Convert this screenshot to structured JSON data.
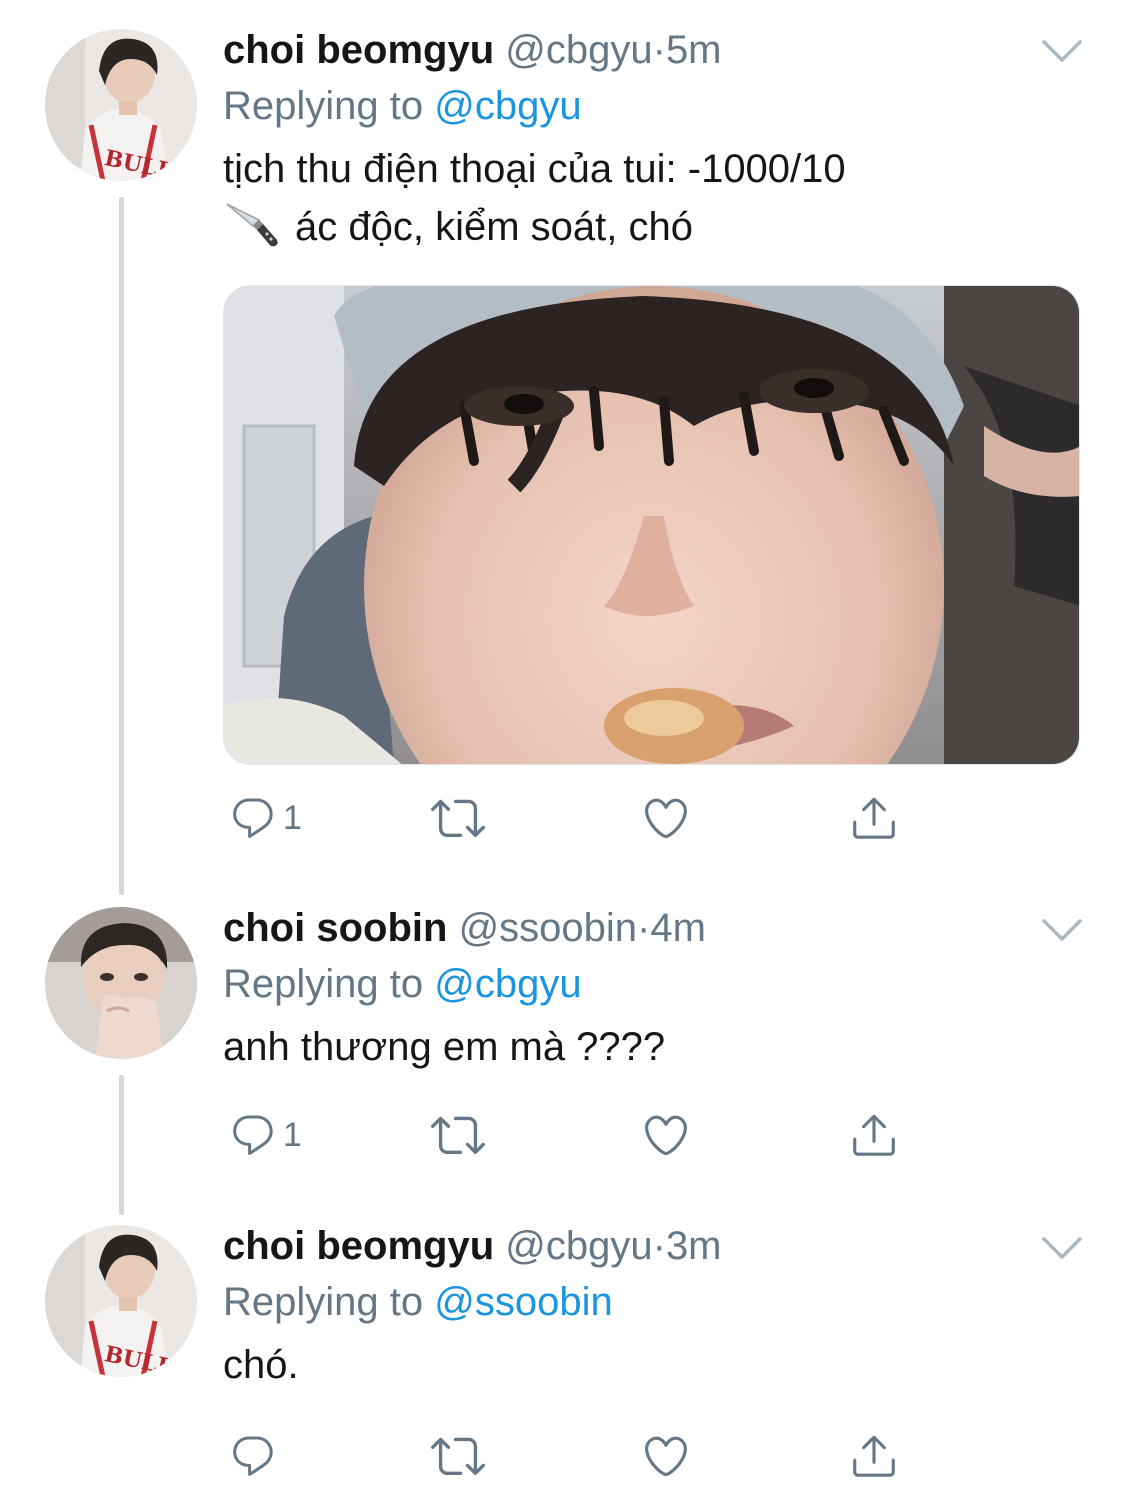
{
  "colors": {
    "text": "#14171a",
    "secondary": "#657786",
    "link": "#1b95e0",
    "thread_line": "#cfd9de",
    "background": "#ffffff"
  },
  "tweets": [
    {
      "display_name": "choi beomgyu",
      "handle": "@cbgyu",
      "separator": "·",
      "time": "5m",
      "replying_prefix": "Replying to",
      "replying_to": "@cbgyu",
      "text_line1": "tịch thu điện thoại của tui: -1000/10",
      "emoji": "knife-icon",
      "text_line2": "ác độc, kiểm soát, chó",
      "has_media": true,
      "reply_count": "1",
      "retweet_count": "",
      "like_count": ""
    },
    {
      "display_name": "choi soobin",
      "handle": "@ssoobin",
      "separator": "·",
      "time": "4m",
      "replying_prefix": "Replying to",
      "replying_to": "@cbgyu",
      "text_line1": "anh thương em mà ????",
      "reply_count": "1",
      "retweet_count": "",
      "like_count": ""
    },
    {
      "display_name": "choi beomgyu",
      "handle": "@cbgyu",
      "separator": "·",
      "time": "3m",
      "replying_prefix": "Replying to",
      "replying_to": "@ssoobin",
      "text_line1": "chó.",
      "reply_count": "",
      "retweet_count": "",
      "like_count": ""
    }
  ]
}
